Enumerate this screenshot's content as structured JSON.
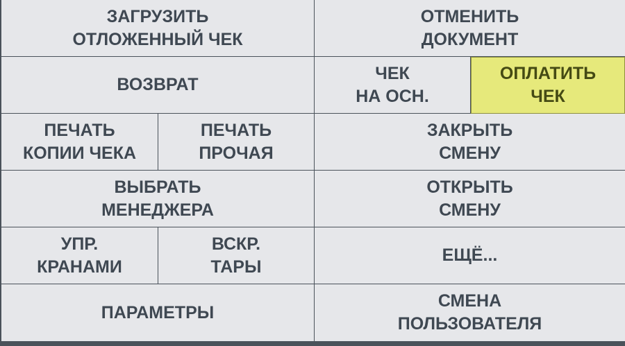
{
  "buttons": {
    "load_deferred": "ЗАГРУЗИТЬ\nОТЛОЖЕННЫЙ ЧЕК",
    "cancel_document": "ОТМЕНИТЬ\nДОКУМЕНТ",
    "return": "ВОЗВРАТ",
    "receipt_based": "ЧЕК\nНА ОСН.",
    "pay_receipt": "ОПЛАТИТЬ\nЧЕК",
    "print_copy": "ПЕЧАТЬ\nКОПИИ ЧЕКА",
    "print_other": "ПЕЧАТЬ\nПРОЧАЯ",
    "close_shift": "ЗАКРЫТЬ\nСМЕНУ",
    "select_manager": "ВЫБРАТЬ\nМЕНЕДЖЕРА",
    "open_shift": "ОТКРЫТЬ\nСМЕНУ",
    "tap_control": "УПР.\nКРАНАМИ",
    "open_container": "ВСКР.\nТАРЫ",
    "more": "ЕЩЁ...",
    "parameters": "ПАРАМЕТРЫ",
    "change_user": "СМЕНА\nПОЛЬЗОВАТЕЛЯ"
  },
  "colors": {
    "background": "#e6e7ea",
    "text": "#3f4852",
    "accent": "#e6e97b",
    "border": "#4a525a"
  }
}
